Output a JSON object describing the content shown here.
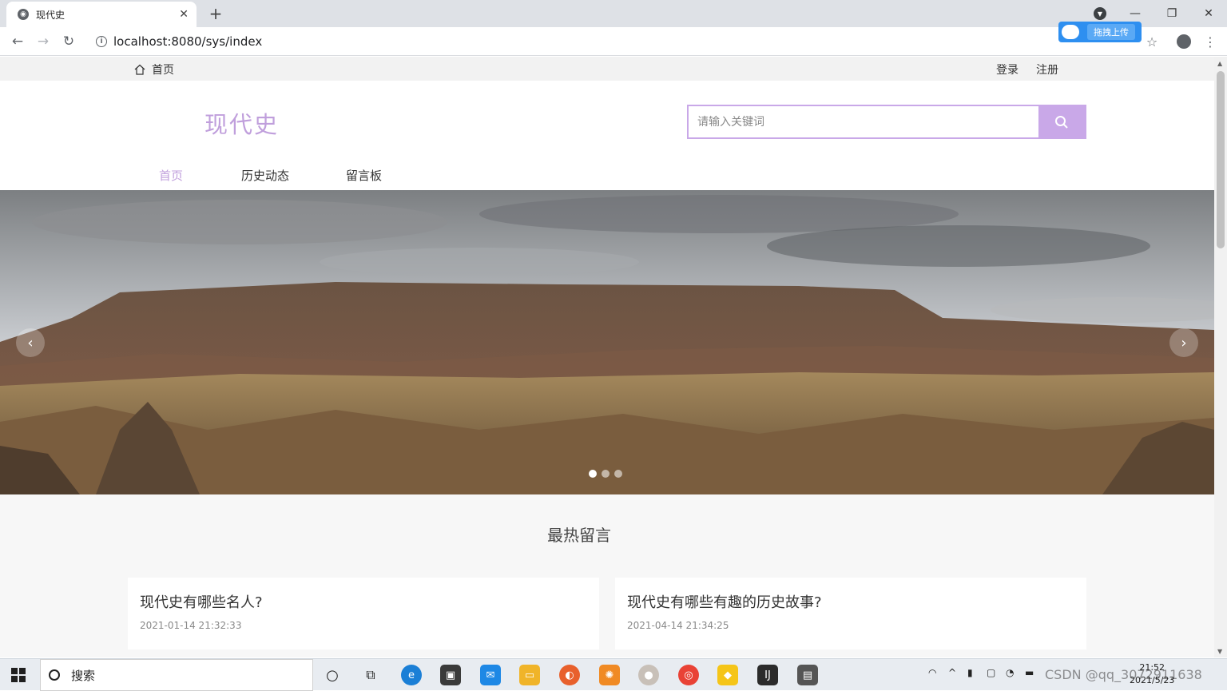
{
  "browser": {
    "tab_title": "现代史",
    "url": "localhost:8080/sys/index",
    "extension_label": "拖拽上传"
  },
  "topbar": {
    "home_label": "首页",
    "login_label": "登录",
    "register_label": "注册"
  },
  "header": {
    "logo": "现代史",
    "search_placeholder": "请输入关键词"
  },
  "nav": {
    "items": [
      {
        "label": "首页",
        "active": true
      },
      {
        "label": "历史动态",
        "active": false
      },
      {
        "label": "留言板",
        "active": false
      }
    ]
  },
  "carousel": {
    "slide_count": 3,
    "active_index": 0
  },
  "hot_section": {
    "title": "最热留言",
    "cards": [
      {
        "title": "现代史有哪些名人?",
        "date": "2021-01-14 21:32:33"
      },
      {
        "title": "现代史有哪些有趣的历史故事?",
        "date": "2021-04-14 21:34:25"
      }
    ]
  },
  "taskbar": {
    "search_label": "搜索",
    "time": "21:52",
    "date": "2021/5/23",
    "watermark": "CSDN @qq_3072911638"
  },
  "colors": {
    "accent": "#c09fdc",
    "accent_light": "#c9a8e8"
  }
}
